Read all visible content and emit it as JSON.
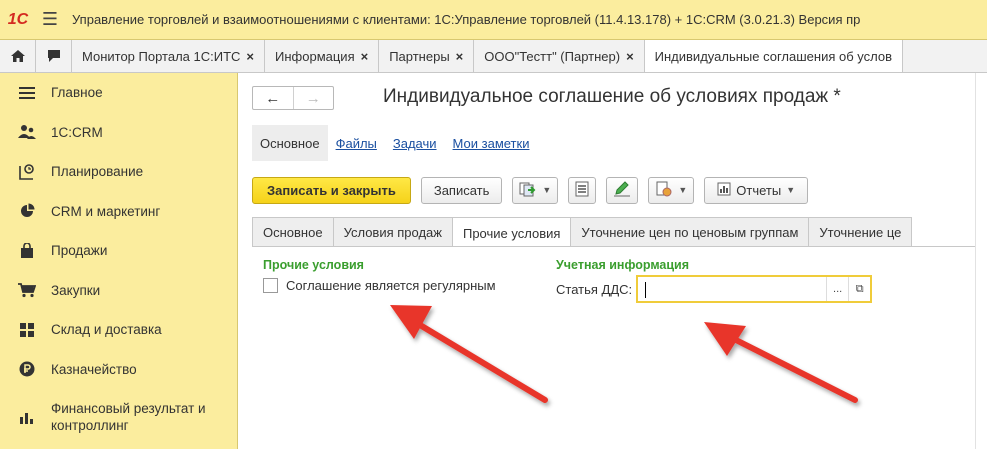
{
  "window": {
    "logo": "1С",
    "title": "Управление торговлей и взаимоотношениями с клиентами: 1С:Управление торговлей (11.4.13.178) + 1С:CRM (3.0.21.3) Версия пр"
  },
  "tabs": [
    {
      "label": "Монитор Портала 1С:ИТС",
      "close": "×"
    },
    {
      "label": "Информация",
      "close": "×"
    },
    {
      "label": "Партнеры",
      "close": "×"
    },
    {
      "label": "ООО\"Тестт\" (Партнер)",
      "close": "×"
    },
    {
      "label": "Индивидуальные соглашения об услов",
      "close": ""
    }
  ],
  "sidebar": {
    "items": [
      {
        "label": "Главное",
        "icon": "menu-icon"
      },
      {
        "label": "1С:CRM",
        "icon": "users-icon"
      },
      {
        "label": "Планирование",
        "icon": "planning-icon"
      },
      {
        "label": "CRM и маркетинг",
        "icon": "pie-chart-icon"
      },
      {
        "label": "Продажи",
        "icon": "bag-icon"
      },
      {
        "label": "Закупки",
        "icon": "cart-icon"
      },
      {
        "label": "Склад и доставка",
        "icon": "warehouse-icon"
      },
      {
        "label": "Казначейство",
        "icon": "ruble-icon"
      },
      {
        "label": "Финансовый результат и",
        "label2": "контроллинг",
        "icon": "bar-chart-icon"
      }
    ]
  },
  "document": {
    "title": "Индивидуальное соглашение об условиях продаж *",
    "nav_back": "←",
    "nav_forward": "→",
    "section_links": [
      {
        "label": "Основное",
        "active": true
      },
      {
        "label": "Файлы",
        "active": false
      },
      {
        "label": "Задачи",
        "active": false
      },
      {
        "label": "Мои заметки",
        "active": false
      }
    ],
    "toolbar": {
      "save_close": "Записать и закрыть",
      "save": "Записать",
      "reports": "Отчеты"
    },
    "form_tabs": [
      {
        "label": "Основное",
        "active": false
      },
      {
        "label": "Условия продаж",
        "active": false
      },
      {
        "label": "Прочие условия",
        "active": true
      },
      {
        "label": "Уточнение цен по ценовым группам",
        "active": false
      },
      {
        "label": "Уточнение це",
        "active": false
      }
    ],
    "other_conditions": {
      "group_title": "Прочие условия",
      "checkbox_label": "Соглашение является регулярным",
      "checked": false
    },
    "account_info": {
      "group_title": "Учетная информация",
      "field_label": "Статья ДДС:",
      "field_value": "",
      "select_button": "...",
      "open_button": "⧉"
    }
  },
  "colors": {
    "accent_yellow": "#fbed9e",
    "primary_button": "#f5d21a",
    "group_title_green": "#3a9e2e",
    "link_blue": "#1a4fa0",
    "arrow_red": "#e8352b"
  }
}
